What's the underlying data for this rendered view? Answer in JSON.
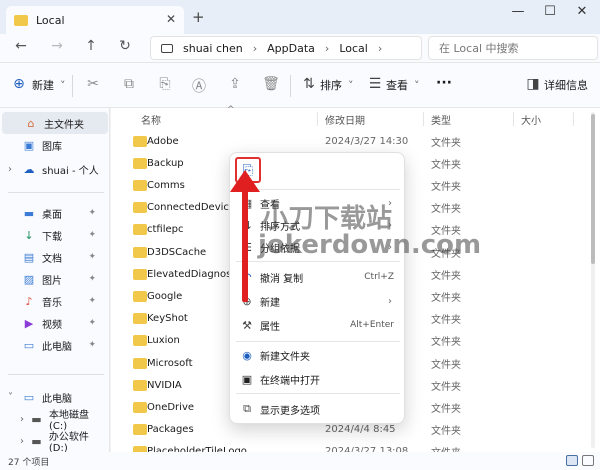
{
  "titlebar": {
    "tab_title": "Local",
    "tab_close": "✕",
    "new_tab": "+",
    "minimize": "—",
    "maximize": "☐",
    "close": "✕"
  },
  "nav": {
    "back": "←",
    "forward": "→",
    "up": "↑",
    "refresh": "↻",
    "breadcrumbs": [
      "shuai chen",
      "AppData",
      "Local"
    ],
    "crumb_sep": "›",
    "search_placeholder": "在 Local 中搜索"
  },
  "toolbar": {
    "new_label": "新建",
    "new_chevron": "˅",
    "sort_label": "排序",
    "view_label": "查看",
    "more": "···",
    "details_label": "详细信息"
  },
  "sidebar": {
    "items": [
      {
        "label": "主文件夹",
        "icon": "home-icon",
        "glyph": "⌂"
      },
      {
        "label": "图库",
        "icon": "gallery-icon",
        "glyph": "▣"
      },
      {
        "label": "shuai - 个人",
        "icon": "cloud-icon",
        "glyph": "☁"
      },
      {
        "label": "桌面",
        "icon": "desktop-icon",
        "glyph": "▬"
      },
      {
        "label": "下载",
        "icon": "download-icon",
        "glyph": "↓"
      },
      {
        "label": "文档",
        "icon": "document-icon",
        "glyph": "▤"
      },
      {
        "label": "图片",
        "icon": "picture-icon",
        "glyph": "▨"
      },
      {
        "label": "音乐",
        "icon": "music-icon",
        "glyph": "♪"
      },
      {
        "label": "视频",
        "icon": "video-icon",
        "glyph": "▶"
      },
      {
        "label": "此电脑",
        "icon": "computer-icon",
        "glyph": "▭"
      },
      {
        "label": "此电脑",
        "icon": "computer-icon",
        "glyph": "▭"
      },
      {
        "label": "本地磁盘 (C:)",
        "icon": "drive-icon",
        "glyph": "▬"
      },
      {
        "label": "办公软件 (D:)",
        "icon": "drive-icon",
        "glyph": "▬"
      }
    ],
    "pin": "📌",
    "expand": "›",
    "collapse": "˅"
  },
  "columns": {
    "name": "名称",
    "modified": "修改日期",
    "type": "类型",
    "size": "大小",
    "sort_caret": "^"
  },
  "files": [
    {
      "name": "Adobe",
      "date": "2024/3/27 14:30",
      "type": "文件夹"
    },
    {
      "name": "Backup",
      "date": "",
      "type": "文件夹"
    },
    {
      "name": "Comms",
      "date": "",
      "type": "文件夹"
    },
    {
      "name": "ConnectedDevicesP",
      "date": "",
      "type": "文件夹"
    },
    {
      "name": "ctfilepc",
      "date": "",
      "type": "文件夹"
    },
    {
      "name": "D3DSCache",
      "date": "",
      "type": "文件夹"
    },
    {
      "name": "ElevatedDiagnostics",
      "date": "",
      "type": "文件夹"
    },
    {
      "name": "Google",
      "date": "",
      "type": "文件夹"
    },
    {
      "name": "KeyShot",
      "date": "",
      "type": "文件夹"
    },
    {
      "name": "Luxion",
      "date": "",
      "type": "文件夹"
    },
    {
      "name": "Microsoft",
      "date": "",
      "type": "文件夹"
    },
    {
      "name": "NVIDIA",
      "date": "",
      "type": "文件夹"
    },
    {
      "name": "OneDrive",
      "date": "",
      "type": "文件夹"
    },
    {
      "name": "Packages",
      "date": "2024/4/4 8:45",
      "type": "文件夹"
    },
    {
      "name": "PlaceholderTileLogoFolder",
      "date": "2024/3/27 13:08",
      "type": "文件夹"
    }
  ],
  "context_menu": {
    "paste_icon": "⎘",
    "items": [
      {
        "label": "查看",
        "icon": "view-icon",
        "glyph": "▦",
        "arrow": "›"
      },
      {
        "label": "排序方式",
        "icon": "sort-icon",
        "glyph": "⇅",
        "arrow": "›"
      },
      {
        "label": "分组依据",
        "icon": "group-icon",
        "glyph": "☰",
        "arrow": "›"
      },
      {
        "label": "撤消 复制",
        "icon": "undo-icon",
        "glyph": "↶",
        "shortcut": "Ctrl+Z"
      },
      {
        "label": "新建",
        "icon": "new-icon",
        "glyph": "⊕",
        "arrow": "›"
      },
      {
        "label": "属性",
        "icon": "wrench-icon",
        "glyph": "🔧",
        "shortcut": "Alt+Enter"
      },
      {
        "label": "新建文件夹",
        "icon": "new-folder-icon",
        "glyph": "◉"
      },
      {
        "label": "在终端中打开",
        "icon": "terminal-icon",
        "glyph": "▣"
      },
      {
        "label": "显示更多选项",
        "icon": "more-options-icon",
        "glyph": "⧉"
      }
    ]
  },
  "statusbar": {
    "count": "27 个项目"
  },
  "watermark": {
    "line1": "小刀下载站",
    "line2": "jokerdown.com",
    "repeat": "jokerdown"
  },
  "colors": {
    "accent": "#1f5fbf",
    "folder": "#f2c84b",
    "highlight_red": "#e02020"
  }
}
